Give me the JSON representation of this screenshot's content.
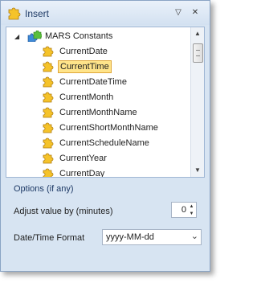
{
  "window": {
    "title": "Insert",
    "pin_symbol": "▽",
    "close_symbol": "✕"
  },
  "tree": {
    "expander_symbol": "◢",
    "root_label": "MARS Constants",
    "items": [
      {
        "label": "CurrentDate",
        "selected": false
      },
      {
        "label": "CurrentTime",
        "selected": true
      },
      {
        "label": "CurrentDateTime",
        "selected": false
      },
      {
        "label": "CurrentMonth",
        "selected": false
      },
      {
        "label": "CurrentMonthName",
        "selected": false
      },
      {
        "label": "CurrentShortMonthName",
        "selected": false
      },
      {
        "label": "CurrentScheduleName",
        "selected": false
      },
      {
        "label": "CurrentYear",
        "selected": false
      },
      {
        "label": "CurrentDay",
        "selected": false
      }
    ],
    "scroll_up_symbol": "▲",
    "scroll_down_symbol": "▼"
  },
  "options": {
    "section_title": "Options (if any)",
    "adjust_label": "Adjust value by (minutes)",
    "adjust_value": "0",
    "spin_up_symbol": "▲",
    "spin_down_symbol": "▼",
    "format_label": "Date/Time Format",
    "format_value": "yyyy-MM-dd",
    "dropdown_symbol": "⌄"
  }
}
